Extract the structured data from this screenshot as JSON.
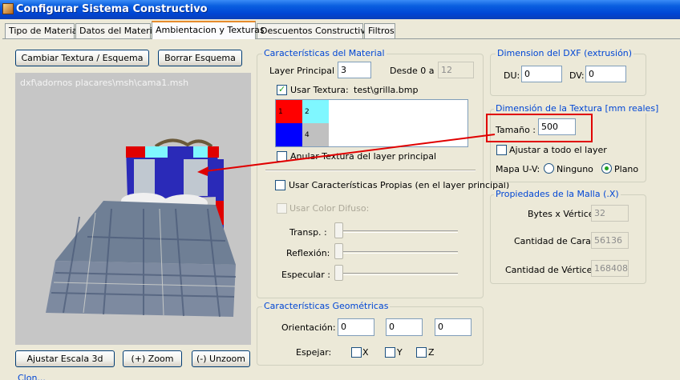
{
  "window": {
    "title": "Configurar Sistema Constructivo"
  },
  "tabs": [
    {
      "label": "Tipo de Material"
    },
    {
      "label": "Datos del Material"
    },
    {
      "label": "Ambientacion y Texturas"
    },
    {
      "label": "Descuentos Constructivos"
    },
    {
      "label": "Filtros"
    }
  ],
  "left": {
    "change_texture_button": "Cambiar Textura / Esquema",
    "delete_scheme_button": "Borrar Esquema",
    "preview_path": "dxf\\adornos placares\\msh\\cama1.msh",
    "adjust_scale_button": "Ajustar Escala 3d",
    "zoom_in_button": "(+) Zoom",
    "zoom_out_button": "(-) Unzoom",
    "bottom_cutoff_label": "Clon..."
  },
  "material": {
    "legend": "Características del Material",
    "layer_principal_label": "Layer Principal :",
    "layer_principal_value": "3",
    "desde_label": "Desde 0 a",
    "desde_value": "12",
    "usar_textura_label": "Usar Textura:",
    "usar_textura_checked": true,
    "texture_file": "test\\grilla.bmp",
    "swatches": [
      {
        "label": "1",
        "color": "#ff0000"
      },
      {
        "label": "2",
        "color": "#7ff7ff"
      },
      {
        "label": "3",
        "color": "#0000ff"
      },
      {
        "label": "4",
        "color": "#c0c0c0"
      }
    ],
    "anular_label": "Anular Textura del layer principal",
    "usar_props_label": "Usar Características Propias (en el layer principal)",
    "usar_color_label": "Usar Color Difuso:",
    "transp_label": "Transp. :",
    "reflexion_label": "Reflexión:",
    "especular_label": "Especular :"
  },
  "dxf": {
    "legend": "Dimension del DXF (extrusión)",
    "du_label": "DU:",
    "du_value": "0",
    "dv_label": "DV:",
    "dv_value": "0"
  },
  "texture_dim": {
    "legend": "Dimensión de la Textura [mm reales]",
    "tamano_label": "Tamaño :",
    "tamano_value": "500",
    "ajustar_label": "Ajustar a todo el layer",
    "mapa_label": "Mapa U-V:",
    "ninguno_label": "Ninguno",
    "plano_label": "Plano",
    "selected": "Plano"
  },
  "mesh": {
    "legend": "Propiedades de la Malla (.X)",
    "bytes_label": "Bytes x Vértice:",
    "bytes_value": "32",
    "caras_label": "Cantidad de Caras:",
    "caras_value": "56136",
    "vertices_label": "Cantidad de Vértices:",
    "vertices_value": "168408"
  },
  "geometry": {
    "legend": "Características Geométricas",
    "orientacion_label": "Orientación:",
    "orient_values": [
      "0",
      "0",
      "0"
    ],
    "espejar_label": "Espejar:",
    "x_label": "X",
    "y_label": "Y",
    "z_label": "Z"
  },
  "colors": {
    "annotation_red": "#e00000",
    "titlebar_blue": "#0a5fe0",
    "active_tab_accent": "#e68b2c"
  }
}
